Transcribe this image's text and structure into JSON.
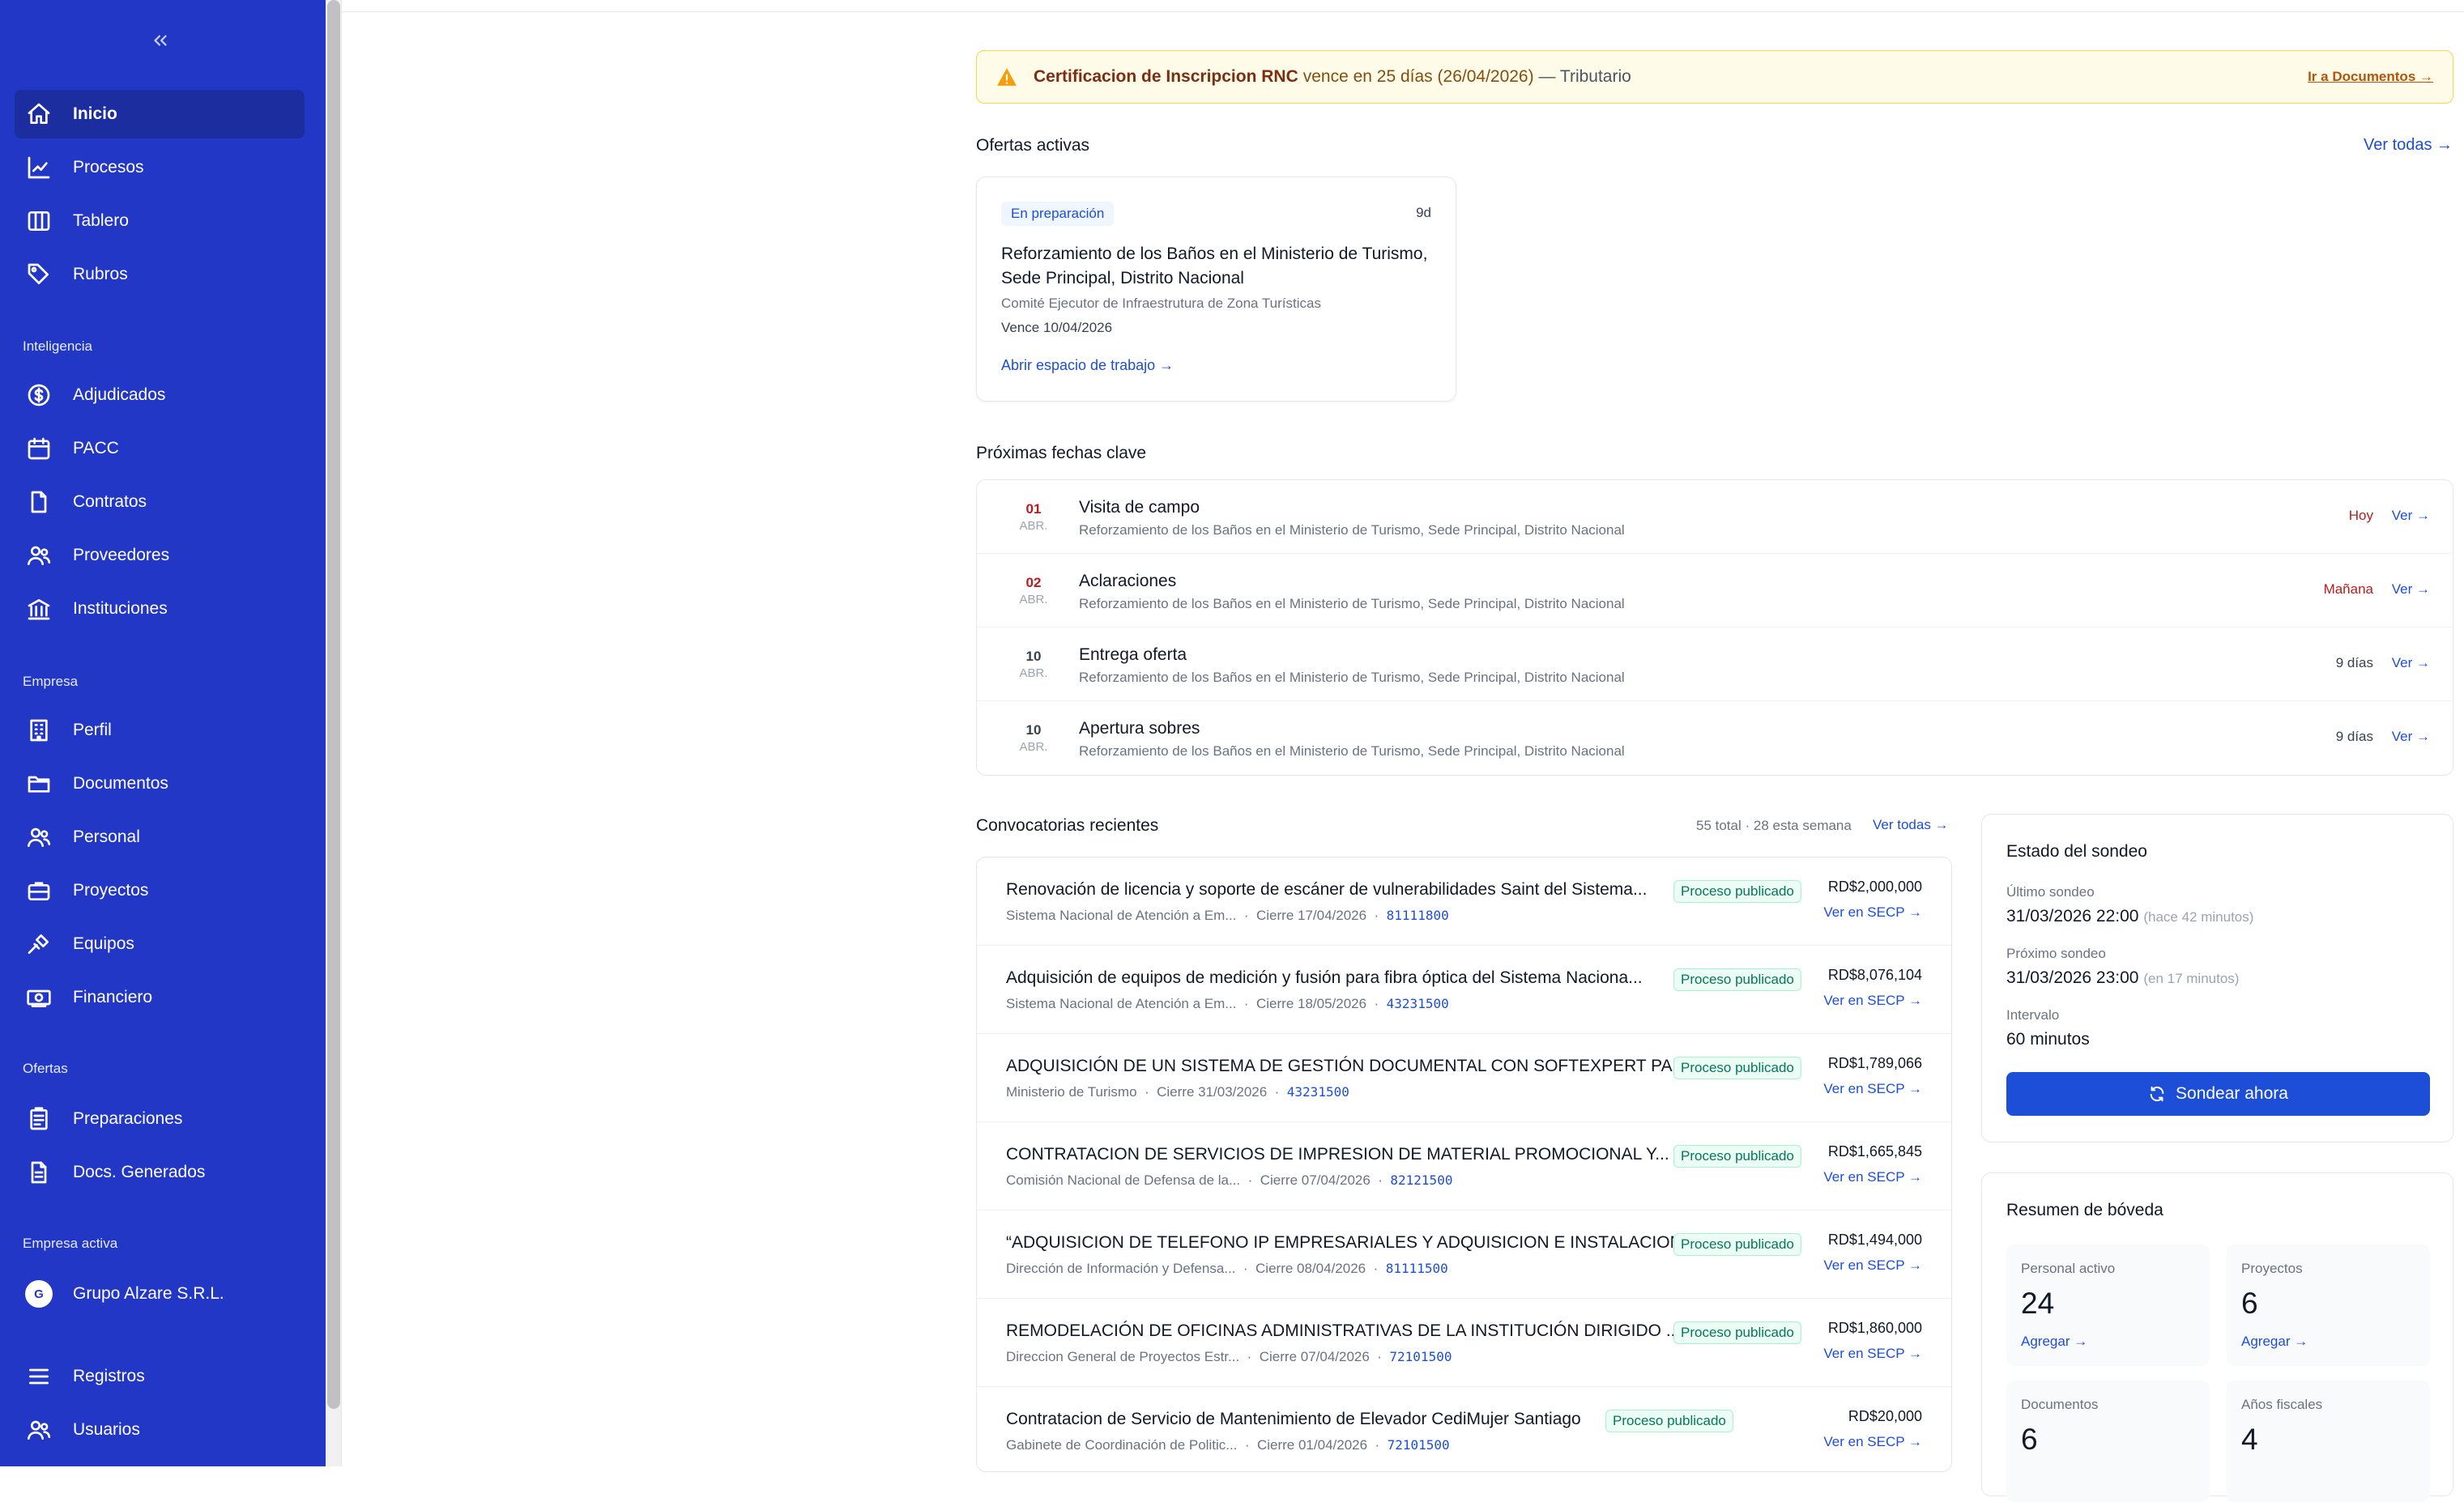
{
  "sidebar": {
    "collapse_icon": "chevrons-left-icon",
    "primary": [
      {
        "label": "Inicio",
        "icon": "home-icon"
      },
      {
        "label": "Procesos",
        "icon": "chart-icon"
      },
      {
        "label": "Tablero",
        "icon": "columns-icon"
      },
      {
        "label": "Rubros",
        "icon": "tag-icon"
      }
    ],
    "section_inteligencia": "Inteligencia",
    "inteligencia": [
      {
        "label": "Adjudicados",
        "icon": "dollar-icon"
      },
      {
        "label": "PACC",
        "icon": "calendar-icon"
      },
      {
        "label": "Contratos",
        "icon": "file-icon"
      },
      {
        "label": "Proveedores",
        "icon": "users-icon"
      },
      {
        "label": "Instituciones",
        "icon": "bank-icon"
      }
    ],
    "section_empresa": "Empresa",
    "empresa": [
      {
        "label": "Perfil",
        "icon": "building-icon"
      },
      {
        "label": "Documentos",
        "icon": "folder-icon"
      },
      {
        "label": "Personal",
        "icon": "users-icon"
      },
      {
        "label": "Proyectos",
        "icon": "briefcase-icon"
      },
      {
        "label": "Equipos",
        "icon": "tools-icon"
      },
      {
        "label": "Financiero",
        "icon": "money-icon"
      }
    ],
    "section_ofertas": "Ofertas",
    "ofertas": [
      {
        "label": "Preparaciones",
        "icon": "clipboard-icon"
      },
      {
        "label": "Docs. Generados",
        "icon": "document-icon"
      }
    ],
    "section_empresa_activa": "Empresa activa",
    "active_company": {
      "initial": "G",
      "label": "Grupo Alzare S.R.L."
    },
    "bottom": [
      {
        "label": "Registros",
        "icon": "list-icon"
      },
      {
        "label": "Usuarios",
        "icon": "users-icon"
      }
    ]
  },
  "alert": {
    "title": "Certificacion de Inscripcion RNC",
    "middle": "vence en 25 días (26/04/2026)",
    "tail": "— Tributario",
    "link": "Ir a Documentos →"
  },
  "ofertas_activas": {
    "heading": "Ofertas activas",
    "link": "Ver todas →",
    "card": {
      "status": "En preparación",
      "days": "9d",
      "title": "Reforzamiento de los Baños en el Ministerio de Turismo, Sede Principal, Distrito Nacional",
      "institution": "Comité Ejecutor de Infraestrutura de Zona Turísticas",
      "due": "Vence 10/04/2026",
      "open": "Abrir espacio de trabajo →"
    }
  },
  "fechas": {
    "heading": "Próximas fechas clave",
    "rows": [
      {
        "day": "01",
        "month": "ABR.",
        "event": "Visita de campo",
        "sub": "Reforzamiento de los Baños en el Ministerio de Turismo, Sede Principal, Distrito Nacional",
        "rel": "Hoy",
        "ver": "Ver →"
      },
      {
        "day": "02",
        "month": "ABR.",
        "event": "Aclaraciones",
        "sub": "Reforzamiento de los Baños en el Ministerio de Turismo, Sede Principal, Distrito Nacional",
        "rel": "Mañana",
        "ver": "Ver →"
      },
      {
        "day": "10",
        "month": "ABR.",
        "event": "Entrega oferta",
        "sub": "Reforzamiento de los Baños en el Ministerio de Turismo, Sede Principal, Distrito Nacional",
        "rel": "9 días",
        "ver": "Ver →"
      },
      {
        "day": "10",
        "month": "ABR.",
        "event": "Apertura sobres",
        "sub": "Reforzamiento de los Baños en el Ministerio de Turismo, Sede Principal, Distrito Nacional",
        "rel": "9 días",
        "ver": "Ver →"
      }
    ]
  },
  "convocatorias": {
    "heading": "Convocatorias recientes",
    "meta": "55 total · 28 esta semana",
    "link": "Ver todas →",
    "rows": [
      {
        "title": "Renovación de licencia y soporte de escáner de vulnerabilidades Saint del Sistema...",
        "status": "Proceso publicado",
        "inst": "Sistema Nacional de Atención a Em...",
        "close": "Cierre 17/04/2026",
        "code": "81111800",
        "amount": "RD$2,000,000",
        "secp": "Ver en SECP →"
      },
      {
        "title": "Adquisición de equipos de medición y fusión para fibra óptica del Sistema Naciona...",
        "status": "Proceso publicado",
        "inst": "Sistema Nacional de Atención a Em...",
        "close": "Cierre 18/05/2026",
        "code": "43231500",
        "amount": "RD$8,076,104",
        "secp": "Ver en SECP →"
      },
      {
        "title": "ADQUISICIÓN DE UN SISTEMA DE GESTIÓN DOCUMENTAL CON SOFTEXPERT PAR...",
        "status": "Proceso publicado",
        "inst": "Ministerio de Turismo",
        "close": "Cierre 31/03/2026",
        "code": "43231500",
        "amount": "RD$1,789,066",
        "secp": "Ver en SECP →"
      },
      {
        "title": "CONTRATACION DE SERVICIOS DE IMPRESION DE MATERIAL PROMOCIONAL Y...",
        "status": "Proceso publicado",
        "inst": "Comisión Nacional de Defensa de la...",
        "close": "Cierre 07/04/2026",
        "code": "82121500",
        "amount": "RD$1,665,845",
        "secp": "Ver en SECP →"
      },
      {
        "title": "“ADQUISICION DE TELEFONO IP EMPRESARIALES Y ADQUISICION E INSTALACION...",
        "status": "Proceso publicado",
        "inst": "Dirección de Información y Defensa...",
        "close": "Cierre 08/04/2026",
        "code": "81111500",
        "amount": "RD$1,494,000",
        "secp": "Ver en SECP →"
      },
      {
        "title": "REMODELACIÓN DE OFICINAS ADMINISTRATIVAS DE LA INSTITUCIÓN DIRIGIDO ...",
        "status": "Proceso publicado",
        "inst": "Direccion General de Proyectos Estr...",
        "close": "Cierre 07/04/2026",
        "code": "72101500",
        "amount": "RD$1,860,000",
        "secp": "Ver en SECP →"
      },
      {
        "title": "Contratacion de Servicio de Mantenimiento de Elevador CediMujer Santiago",
        "status": "Proceso publicado",
        "inst": "Gabinete de Coordinación de Politic...",
        "close": "Cierre 01/04/2026",
        "code": "72101500",
        "amount": "RD$20,000",
        "secp": "Ver en SECP →"
      }
    ]
  },
  "sondeo": {
    "heading": "Estado del sondeo",
    "last_label": "Último sondeo",
    "last_value": "31/03/2026 22:00",
    "last_rel": "(hace 42 minutos)",
    "next_label": "Próximo sondeo",
    "next_value": "31/03/2026 23:00",
    "next_rel": "(en 17 minutos)",
    "interval_label": "Intervalo",
    "interval_value": "60 minutos",
    "button": "Sondear ahora",
    "button_icon": "refresh-icon"
  },
  "boveda": {
    "heading": "Resumen de bóveda",
    "stats": [
      {
        "label": "Personal activo",
        "value": "24",
        "action": "Agregar →"
      },
      {
        "label": "Proyectos",
        "value": "6",
        "action": "Agregar →"
      },
      {
        "label": "Documentos",
        "value": "6",
        "action": ""
      },
      {
        "label": "Años fiscales",
        "value": "4",
        "action": ""
      }
    ]
  },
  "colors": {
    "sidebar": "#2337c6",
    "sidebar_active": "#1c2da0",
    "accent": "#1d4ed8",
    "urgent": "#b91c1c",
    "published": "#047857"
  }
}
